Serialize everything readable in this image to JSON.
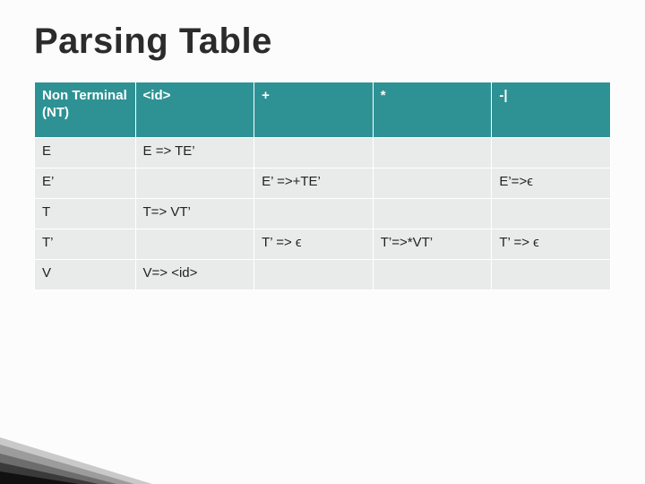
{
  "title": "Parsing Table",
  "columns": [
    "Non Terminal (NT)",
    "<id>",
    "+",
    "*",
    "-|"
  ],
  "rows": [
    {
      "nt": "E",
      "cells": [
        "E => TE’",
        "",
        "",
        ""
      ]
    },
    {
      "nt": "E’",
      "cells": [
        "",
        "E’ =>+TE’",
        "",
        "E’=>ϵ"
      ]
    },
    {
      "nt": "T",
      "cells": [
        "T=> VT’",
        "",
        "",
        ""
      ]
    },
    {
      "nt": "T’",
      "cells": [
        "",
        "T’ => ϵ",
        "T’=>*VT’",
        "T’ => ϵ"
      ]
    },
    {
      "nt": "V",
      "cells": [
        "V=> <id>",
        "",
        "",
        ""
      ]
    }
  ]
}
